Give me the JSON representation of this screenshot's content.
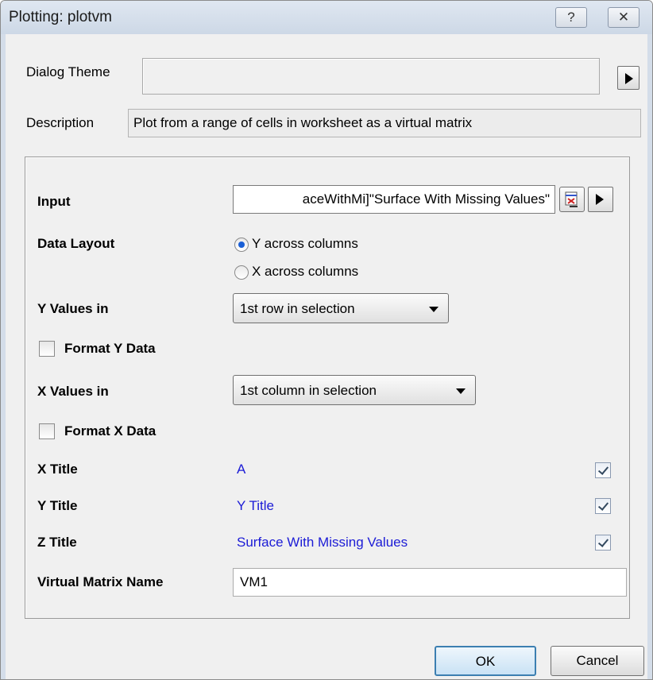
{
  "window": {
    "title": "Plotting: plotvm",
    "help_glyph": "?",
    "close_glyph": "✕"
  },
  "dialog_theme": {
    "label": "Dialog Theme",
    "value": ""
  },
  "description": {
    "label": "Description",
    "text": "Plot from a range of cells in worksheet as a virtual matrix"
  },
  "form": {
    "input": {
      "label": "Input",
      "value": "aceWithMi]\"Surface With Missing Values\""
    },
    "data_layout": {
      "label": "Data Layout",
      "options": [
        {
          "label": "Y across columns",
          "selected": true
        },
        {
          "label": "X across columns",
          "selected": false
        }
      ]
    },
    "y_values_in": {
      "label": "Y Values in",
      "selected": "1st row in selection"
    },
    "format_y_data": {
      "label": "Format Y Data",
      "checked": false
    },
    "x_values_in": {
      "label": "X Values in",
      "selected": "1st column in selection"
    },
    "format_x_data": {
      "label": "Format X Data",
      "checked": false
    },
    "x_title": {
      "label": "X Title",
      "value": "A",
      "checked": true
    },
    "y_title": {
      "label": "Y Title",
      "value": "Y Title",
      "checked": true
    },
    "z_title": {
      "label": "Z Title",
      "value": "Surface With Missing Values",
      "checked": true
    },
    "virtual_matrix_name": {
      "label": "Virtual Matrix Name",
      "value": "VM1"
    }
  },
  "buttons": {
    "ok": "OK",
    "cancel": "Cancel"
  },
  "colors": {
    "link_blue": "#1c1cd6",
    "radio_selected": "#1a5fd6",
    "default_button_border": "#3c7fb1"
  }
}
